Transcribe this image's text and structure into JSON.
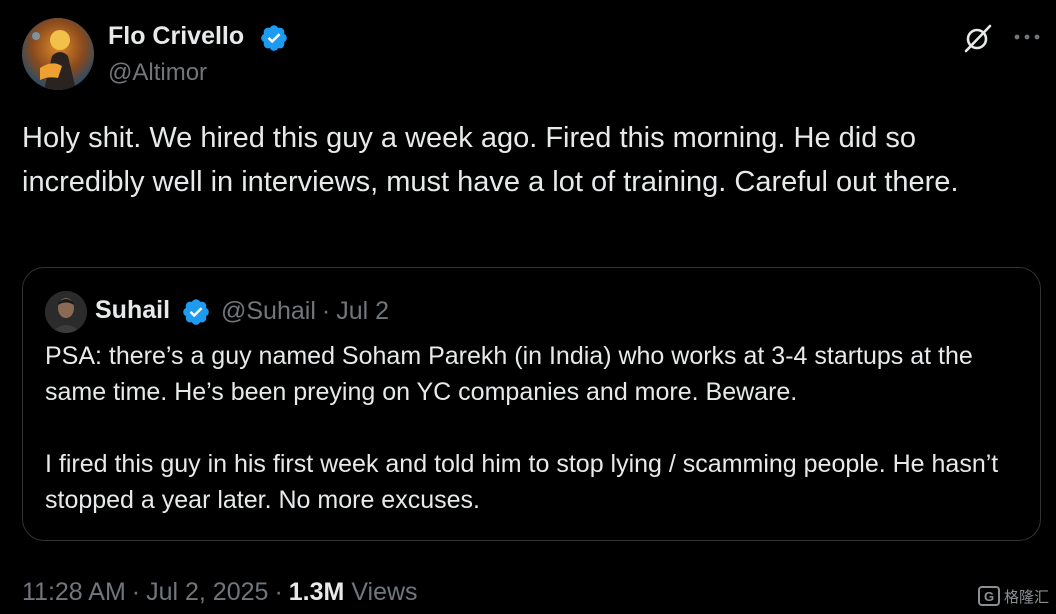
{
  "tweet": {
    "author": {
      "name": "Flo Crivello",
      "handle": "@Altimor",
      "verified": true
    },
    "text": "Holy shit. We hired this guy a week ago. Fired this morning. He did so incredibly well in interviews, must have a lot of training. Careful out there.",
    "quote": {
      "author": {
        "name": "Suhail",
        "handle": "@Suhail",
        "verified": true
      },
      "separator": "·",
      "date": "Jul 2",
      "paragraphs": [
        "PSA: there’s a guy named Soham Parekh (in India) who works at 3-4 startups at the same time. He’s been preying on YC companies and more. Beware.",
        "I fired this guy in his first week and told him to stop lying / scamming people. He hasn’t stopped a year later. No more excuses."
      ]
    },
    "footer": {
      "time": "11:28 AM",
      "separator": "·",
      "date": "Jul 2, 2025",
      "views_count": "1.3M",
      "views_label": "Views"
    }
  },
  "icons": {
    "verified": "verified-badge-icon",
    "grok": "grok-icon",
    "more": "more-icon"
  },
  "watermark": {
    "logo_letter": "G",
    "text": "格隆汇"
  },
  "colors": {
    "background": "#000000",
    "primary_text": "#e7e9ea",
    "secondary_text": "#71767b",
    "verified_blue": "#1d9bf0",
    "border": "#2f3336"
  }
}
